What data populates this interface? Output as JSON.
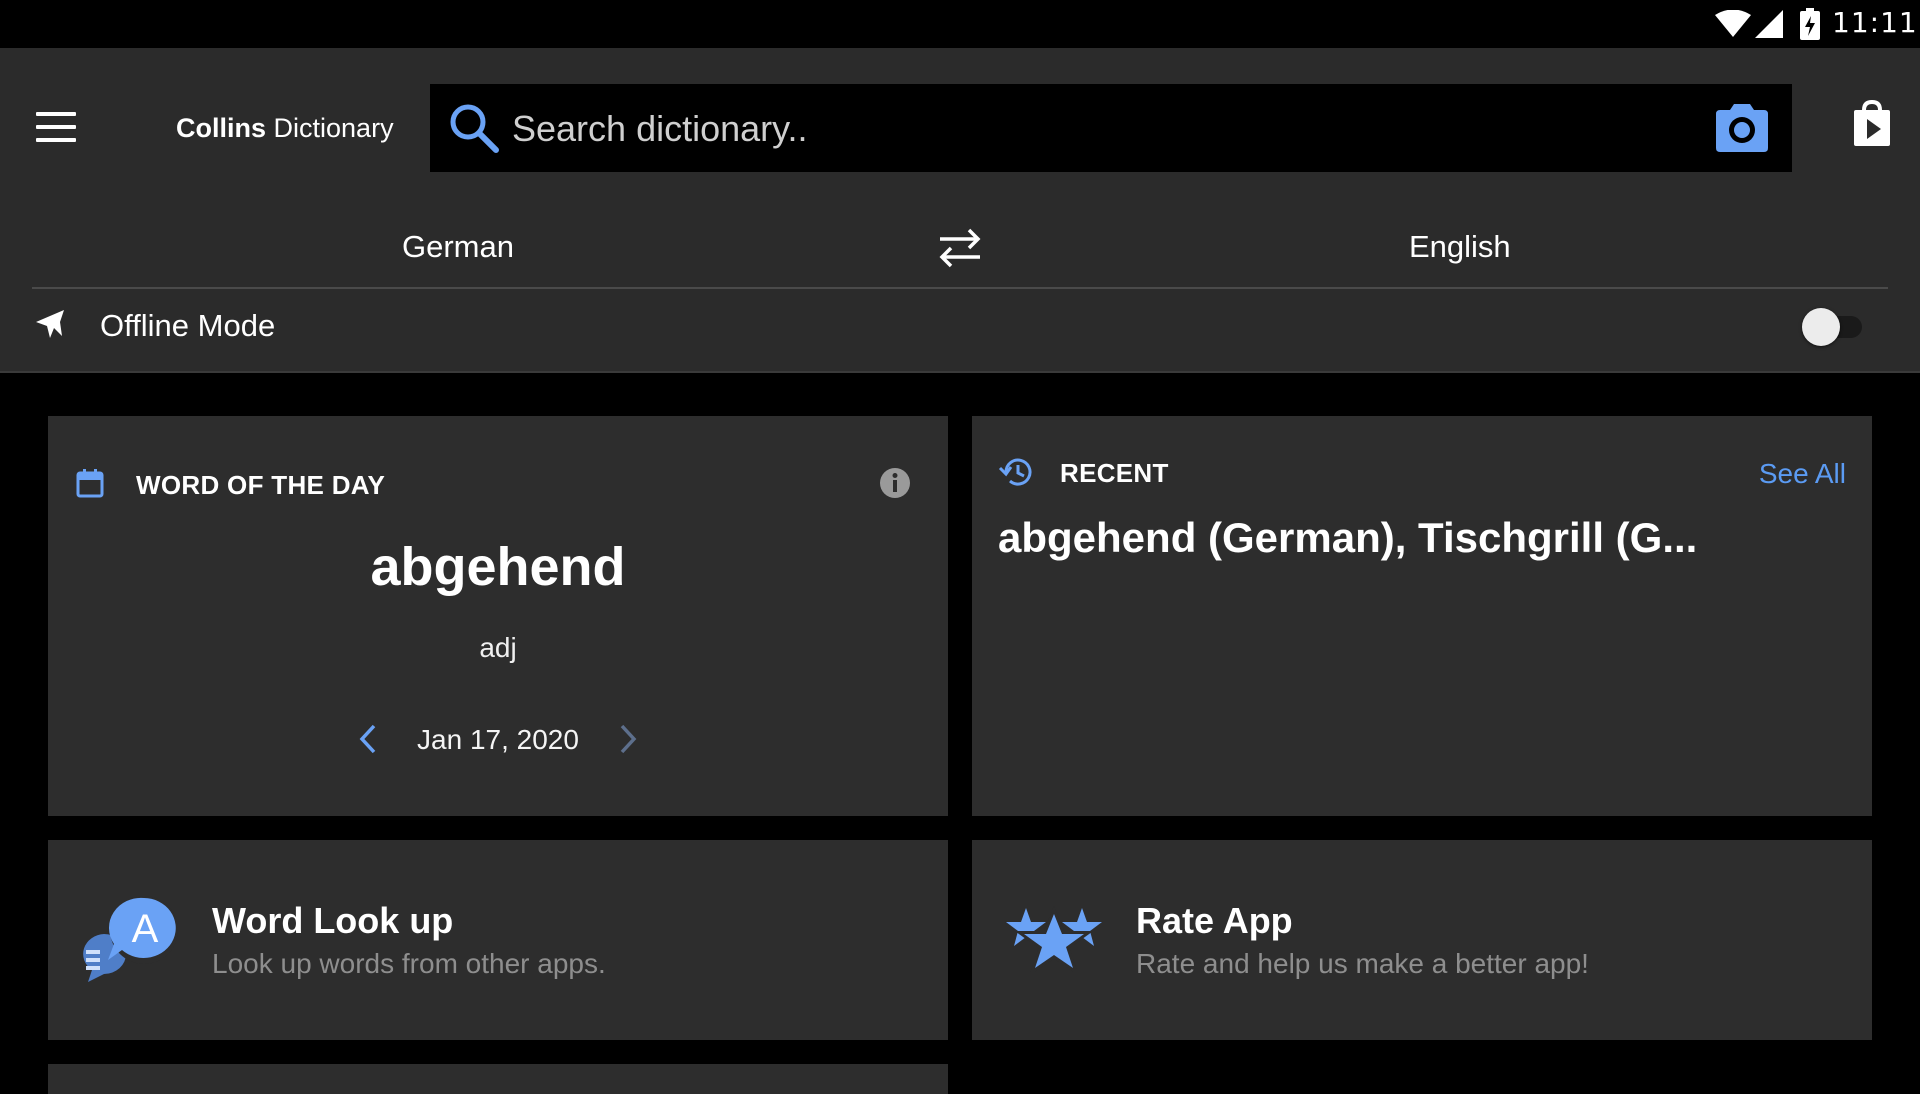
{
  "status_bar": {
    "time": "11:11",
    "icons": [
      "wifi-icon",
      "signal-icon",
      "battery-charging-icon"
    ]
  },
  "header": {
    "brand_bold": "Collins",
    "brand_light": "Dictionary",
    "search_placeholder": "Search dictionary..",
    "icons": [
      "menu-icon",
      "search-icon",
      "camera-icon",
      "store-icon"
    ]
  },
  "languages": {
    "source": "German",
    "target": "English",
    "swap_icon": "swap-arrows-icon"
  },
  "offline": {
    "label": "Offline Mode",
    "enabled": false,
    "icon": "airplane-icon"
  },
  "word_of_the_day": {
    "title": "WORD OF THE DAY",
    "word": "abgehend",
    "part_of_speech": "adj",
    "date": "Jan 17, 2020",
    "icons": [
      "calendar-icon",
      "info-icon",
      "chevron-left-icon",
      "chevron-right-icon"
    ]
  },
  "recent": {
    "title": "RECENT",
    "see_all": "See All",
    "items": "abgehend (German), Tischgrill (G..."
  },
  "word_lookup": {
    "title": "Word Look up",
    "subtitle": "Look up words from other apps.",
    "icon_letter": "A"
  },
  "rate_app": {
    "title": "Rate App",
    "subtitle": "Rate and help us make a better app!"
  },
  "colors": {
    "accent_blue": "#5b9bf3",
    "header_bg": "#2b2b2b",
    "card_bg": "#2d2d2d",
    "page_bg": "#000000",
    "muted_text": "#8e8e8e"
  }
}
